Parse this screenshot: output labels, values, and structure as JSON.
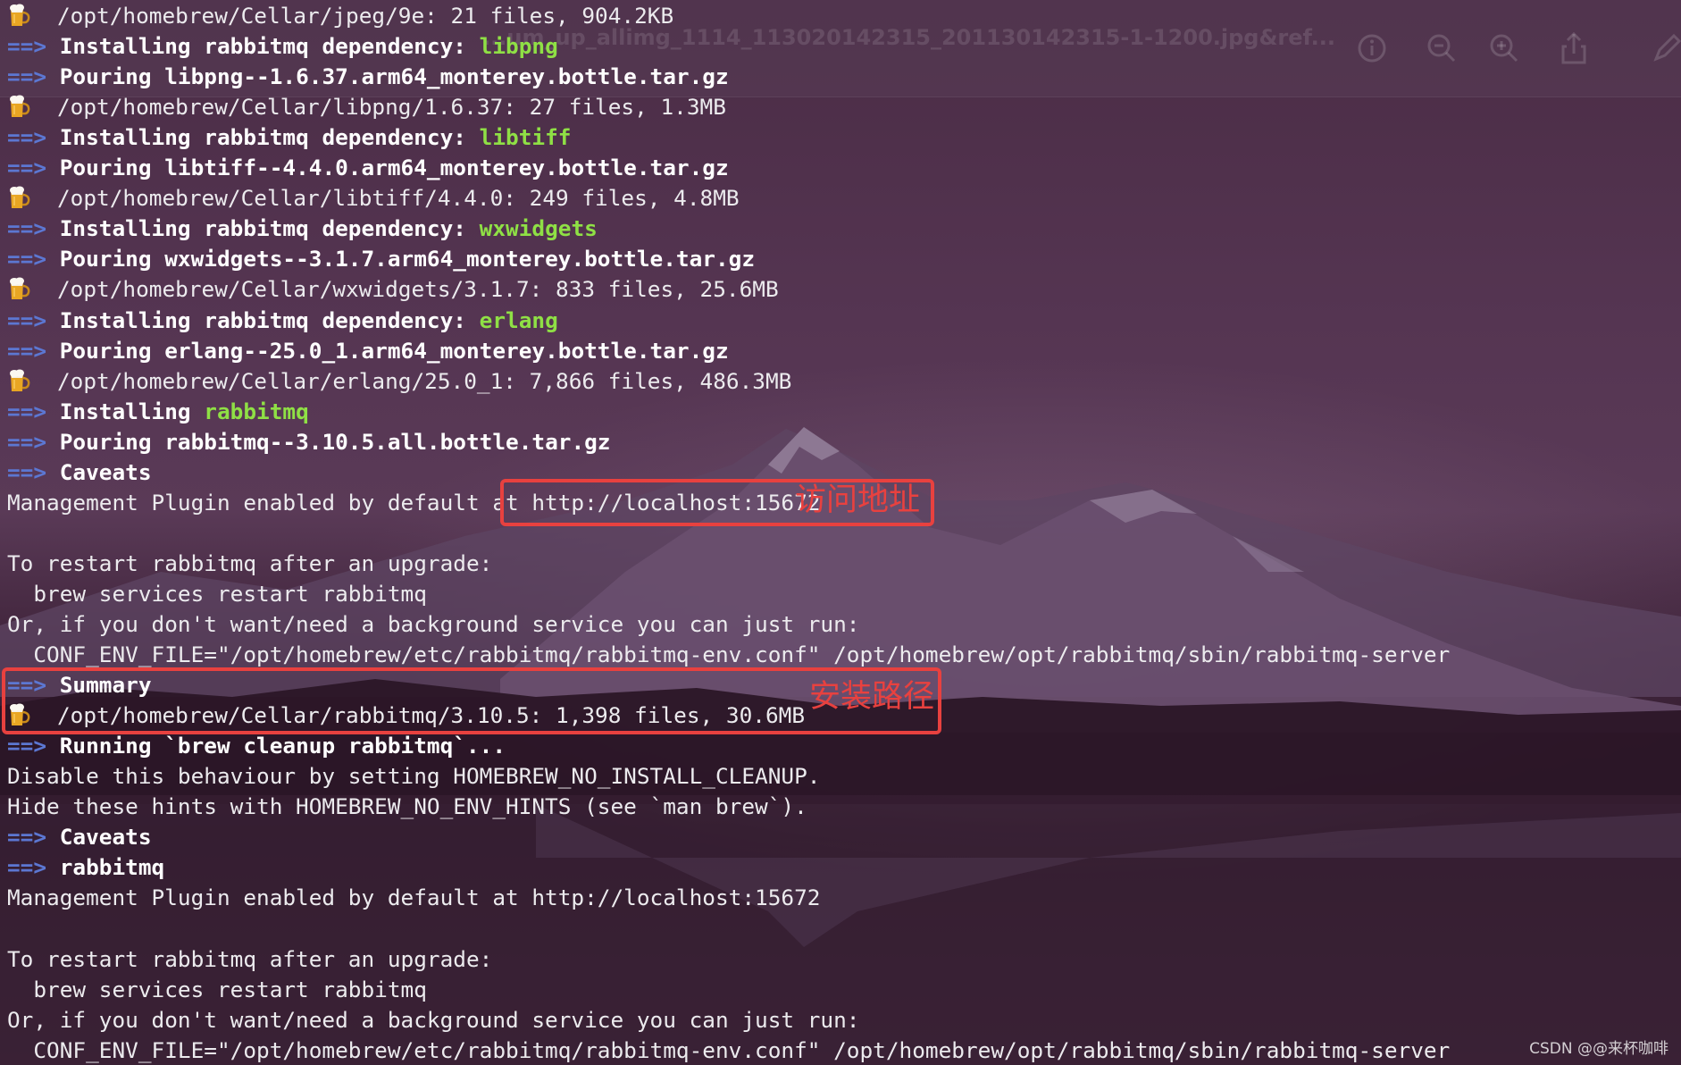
{
  "viewer": {
    "title": "...um_up_allimg_1114_113020142315_201130142315-1-1200.jpg&ref..."
  },
  "terminal": {
    "lines": [
      {
        "type": "beer",
        "text": "/opt/homebrew/Cellar/jpeg/9e: 21 files, 904.2KB"
      },
      {
        "type": "arrow",
        "prefix": "Installing rabbitmq dependency: ",
        "highlight": "libpng"
      },
      {
        "type": "arrow",
        "prefix": "Pouring libpng--1.6.37.arm64_monterey.bottle.tar.gz",
        "highlight": ""
      },
      {
        "type": "beer",
        "text": "/opt/homebrew/Cellar/libpng/1.6.37: 27 files, 1.3MB"
      },
      {
        "type": "arrow",
        "prefix": "Installing rabbitmq dependency: ",
        "highlight": "libtiff"
      },
      {
        "type": "arrow",
        "prefix": "Pouring libtiff--4.4.0.arm64_monterey.bottle.tar.gz",
        "highlight": ""
      },
      {
        "type": "beer",
        "text": "/opt/homebrew/Cellar/libtiff/4.4.0: 249 files, 4.8MB"
      },
      {
        "type": "arrow",
        "prefix": "Installing rabbitmq dependency: ",
        "highlight": "wxwidgets"
      },
      {
        "type": "arrow",
        "prefix": "Pouring wxwidgets--3.1.7.arm64_monterey.bottle.tar.gz",
        "highlight": ""
      },
      {
        "type": "beer",
        "text": "/opt/homebrew/Cellar/wxwidgets/3.1.7: 833 files, 25.6MB"
      },
      {
        "type": "arrow",
        "prefix": "Installing rabbitmq dependency: ",
        "highlight": "erlang"
      },
      {
        "type": "arrow",
        "prefix": "Pouring erlang--25.0_1.arm64_monterey.bottle.tar.gz",
        "highlight": ""
      },
      {
        "type": "beer",
        "text": "/opt/homebrew/Cellar/erlang/25.0_1: 7,866 files, 486.3MB"
      },
      {
        "type": "arrow",
        "prefix": "Installing ",
        "highlight": "rabbitmq"
      },
      {
        "type": "arrow",
        "prefix": "Pouring rabbitmq--3.10.5.all.bottle.tar.gz",
        "highlight": ""
      },
      {
        "type": "arrow",
        "prefix": "Caveats",
        "highlight": ""
      },
      {
        "type": "plain",
        "text": "Management Plugin enabled by default at http://localhost:15672"
      },
      {
        "type": "plain",
        "text": ""
      },
      {
        "type": "plain",
        "text": "To restart rabbitmq after an upgrade:"
      },
      {
        "type": "plain",
        "text": "  brew services restart rabbitmq"
      },
      {
        "type": "plain",
        "text": "Or, if you don't want/need a background service you can just run:"
      },
      {
        "type": "plain",
        "text": "  CONF_ENV_FILE=\"/opt/homebrew/etc/rabbitmq/rabbitmq-env.conf\" /opt/homebrew/opt/rabbitmq/sbin/rabbitmq-server"
      },
      {
        "type": "arrow",
        "prefix": "Summary",
        "highlight": ""
      },
      {
        "type": "beer",
        "text": "/opt/homebrew/Cellar/rabbitmq/3.10.5: 1,398 files, 30.6MB"
      },
      {
        "type": "arrow",
        "prefix": "Running `brew cleanup rabbitmq`...",
        "highlight": ""
      },
      {
        "type": "plain",
        "text": "Disable this behaviour by setting HOMEBREW_NO_INSTALL_CLEANUP."
      },
      {
        "type": "plain",
        "text": "Hide these hints with HOMEBREW_NO_ENV_HINTS (see `man brew`)."
      },
      {
        "type": "arrow",
        "prefix": "Caveats",
        "highlight": ""
      },
      {
        "type": "arrow",
        "prefix": "rabbitmq",
        "highlight": ""
      },
      {
        "type": "plain",
        "text": "Management Plugin enabled by default at http://localhost:15672"
      },
      {
        "type": "plain",
        "text": ""
      },
      {
        "type": "plain",
        "text": "To restart rabbitmq after an upgrade:"
      },
      {
        "type": "plain",
        "text": "  brew services restart rabbitmq"
      },
      {
        "type": "plain",
        "text": "Or, if you don't want/need a background service you can just run:"
      },
      {
        "type": "plain",
        "text": "  CONF_ENV_FILE=\"/opt/homebrew/etc/rabbitmq/rabbitmq-env.conf\" /opt/homebrew/opt/rabbitmq/sbin/rabbitmq-server"
      }
    ],
    "arrow_symbol": "==>",
    "arrow_color": "#5c77d2",
    "highlight_color": "#8fe045"
  },
  "annotations": {
    "access_address": "访问地址",
    "install_path": "安装路径",
    "color": "#e8413f"
  },
  "watermark": "CSDN @@来杯咖啡",
  "icons": [
    "info-icon",
    "zoom-out-icon",
    "zoom-in-icon",
    "share-icon",
    "edit-icon",
    "beer-icon"
  ]
}
